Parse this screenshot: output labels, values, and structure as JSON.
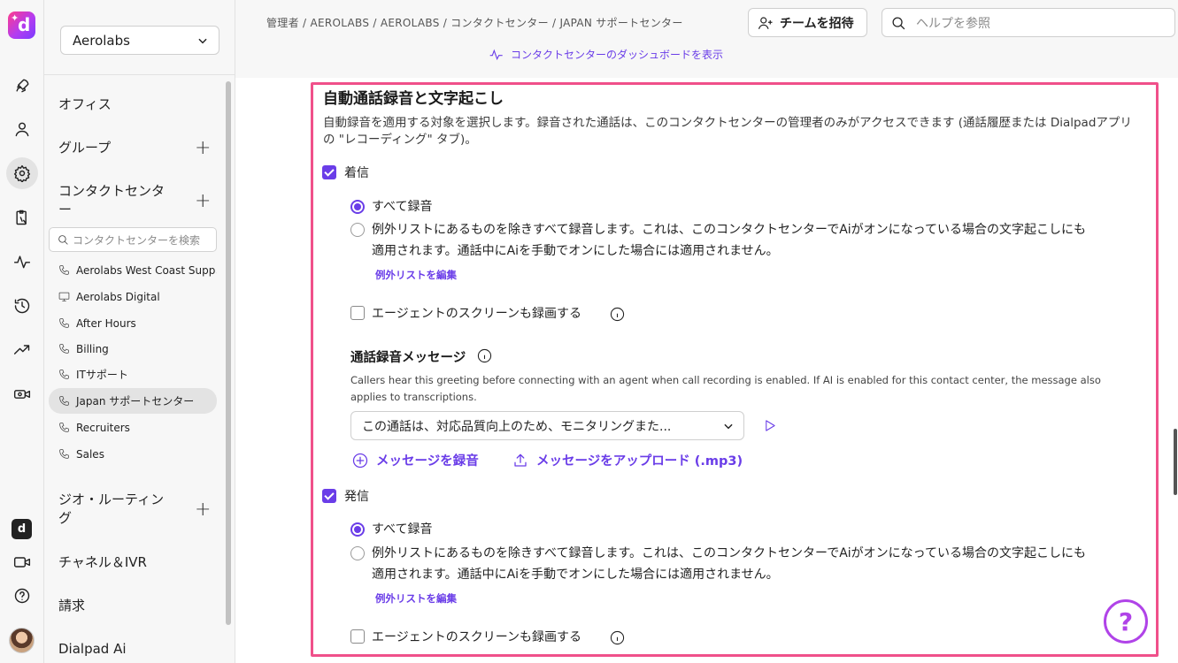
{
  "org_selector": {
    "value": "Aerolabs"
  },
  "sidebar": {
    "items": [
      {
        "label": "オフィス"
      },
      {
        "label": "グループ"
      },
      {
        "label": "コンタクトセンター"
      },
      {
        "label": "ジオ・ルーティング"
      },
      {
        "label": "チャネル＆IVR"
      },
      {
        "label": "請求"
      },
      {
        "label": "Dialpad Ai"
      }
    ],
    "search_placeholder": "コンタクトセンターを検索",
    "contact_centers": [
      {
        "label": "Aerolabs West Coast Supp...",
        "icon": "phone-icon"
      },
      {
        "label": "Aerolabs Digital",
        "icon": "monitor-icon"
      },
      {
        "label": "After Hours",
        "icon": "phone-icon"
      },
      {
        "label": "Billing",
        "icon": "phone-icon"
      },
      {
        "label": "ITサポート",
        "icon": "phone-icon"
      },
      {
        "label": "Japan サポートセンター",
        "icon": "phone-icon",
        "selected": true
      },
      {
        "label": "Recruiters",
        "icon": "phone-icon"
      },
      {
        "label": "Sales",
        "icon": "phone-icon"
      }
    ]
  },
  "header": {
    "breadcrumb": "管理者 / AEROLABS / AEROLABS / コンタクトセンター / JAPAN サポートセンター",
    "dashboard_link": "コンタクトセンターのダッシュボードを表示",
    "invite_button": "チームを招待",
    "help_search_placeholder": "ヘルプを参照"
  },
  "recording": {
    "title": "自動通話録音と文字起こし",
    "description": "自動録音を適用する対象を選択します。録音された通話は、このコンタクトセンターの管理者のみがアクセスできます (通話履歴または Dialpadアプリの \"レコーディング\" タブ)。",
    "incoming": {
      "label": "着信",
      "checked": true,
      "option_all": "すべて録音",
      "option_except_line1": "例外リストにあるものを除きすべて録音します。これは、このコンタクトセンターでAiがオンになっている場合の文字起こしにも",
      "option_except_line2": "適用されます。通話中にAiを手動でオンにした場合には適用されません。",
      "edit_list_link": "例外リストを編集",
      "screen_record_label": "エージェントのスクリーンも録画する",
      "screen_record_checked": false
    },
    "message": {
      "title": "通話録音メッセージ",
      "description": "Callers hear this greeting before connecting with an agent when call recording is enabled. If AI is enabled for this contact center, the message also applies to transcriptions.",
      "selected": "この通話は、対応品質向上のため、モニタリングまた...",
      "record_action": "メッセージを録音",
      "upload_action": "メッセージをアップロード (.mp3)"
    },
    "outgoing": {
      "label": "発信",
      "checked": true,
      "option_all": "すべて録音",
      "option_except_line1": "例外リストにあるものを除きすべて録音します。これは、このコンタクトセンターでAiがオンになっている場合の文字起こしにも",
      "option_except_line2": "適用されます。通話中にAiを手動でオンにした場合には適用されません。",
      "edit_list_link": "例外リストを編集",
      "screen_record_label": "エージェントのスクリーンも録画する",
      "screen_record_checked": false
    }
  },
  "help_fab": {
    "label": "?"
  },
  "colors": {
    "accent": "#6a3de8",
    "highlight_border": "#f0508a",
    "help": "#b043e8"
  }
}
